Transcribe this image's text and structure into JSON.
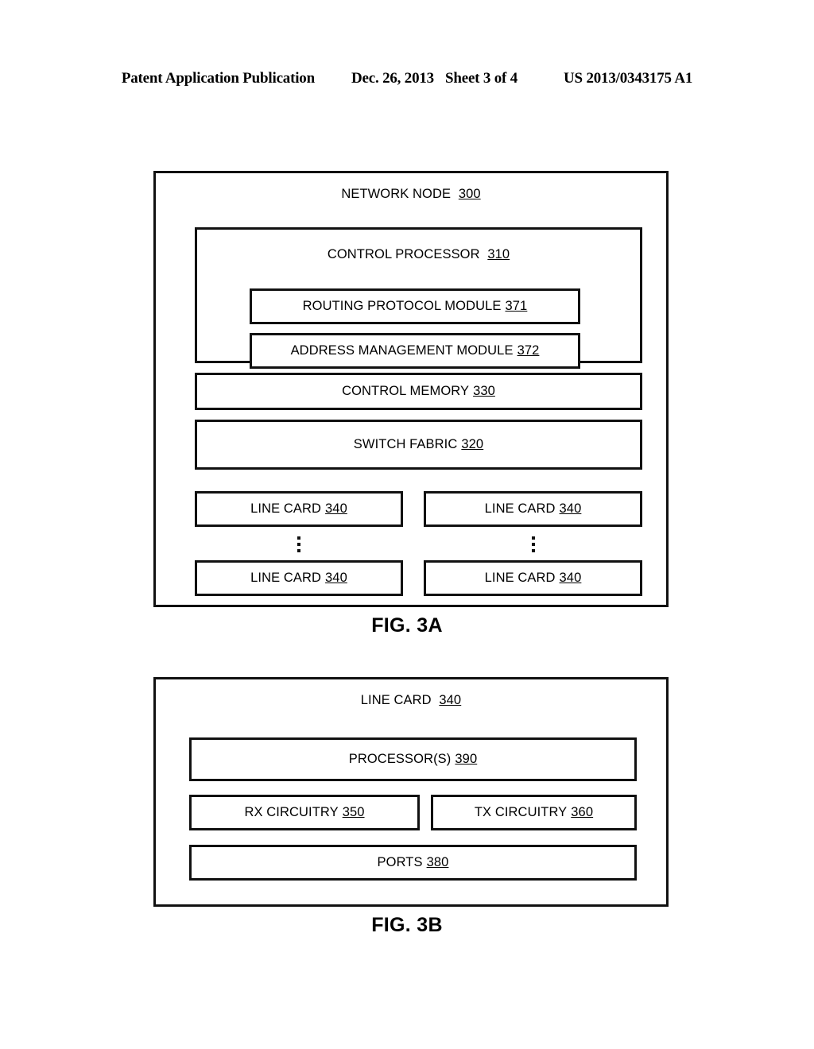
{
  "header": {
    "publication": "Patent Application Publication",
    "date": "Dec. 26, 2013",
    "sheet": "Sheet 3 of 4",
    "patent_number": "US 2013/0343175 A1"
  },
  "figures": [
    {
      "caption": "FIG. 3A",
      "title_text": "NETWORK NODE",
      "title_ref": "300",
      "blocks": {
        "control_processor": {
          "text": "CONTROL PROCESSOR",
          "ref": "310"
        },
        "routing_protocol_module": {
          "text": "ROUTING PROTOCOL MODULE",
          "ref": "371"
        },
        "address_management_module": {
          "text": "ADDRESS MANAGEMENT MODULE",
          "ref": "372"
        },
        "control_memory": {
          "text": "CONTROL MEMORY",
          "ref": "330"
        },
        "switch_fabric": {
          "text": "SWITCH FABRIC",
          "ref": "320"
        },
        "line_card_1": {
          "text": "LINE CARD",
          "ref": "340"
        },
        "line_card_2": {
          "text": "LINE CARD",
          "ref": "340"
        },
        "line_card_3": {
          "text": "LINE CARD",
          "ref": "340"
        },
        "line_card_4": {
          "text": "LINE CARD",
          "ref": "340"
        }
      },
      "ellipsis_glyph": "vertical-ellipsis"
    },
    {
      "caption": "FIG. 3B",
      "title_text": "LINE CARD",
      "title_ref": "340",
      "blocks": {
        "processors": {
          "text": "PROCESSOR(S)",
          "ref": "390"
        },
        "rx_circuitry": {
          "text": "RX CIRCUITRY",
          "ref": "350"
        },
        "tx_circuitry": {
          "text": "TX CIRCUITRY",
          "ref": "360"
        },
        "ports": {
          "text": "PORTS",
          "ref": "380"
        }
      }
    }
  ],
  "colors": {
    "ink": "#111111",
    "paper": "#ffffff"
  }
}
